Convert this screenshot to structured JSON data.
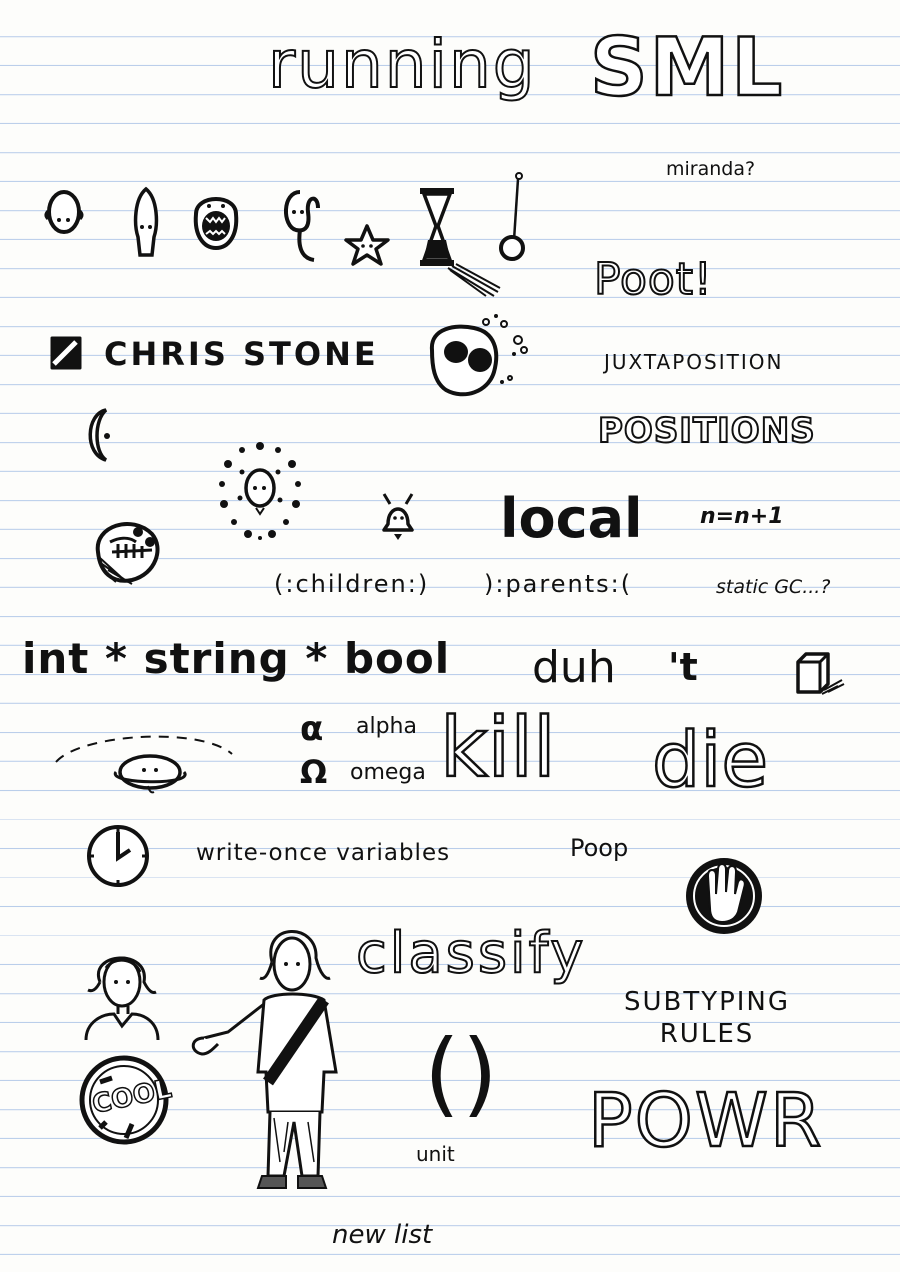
{
  "title": {
    "word1": "running",
    "word2": "SML"
  },
  "words": {
    "miranda": "miranda?",
    "poot": "Poot!",
    "chris_stone": "CHRIS STONE",
    "juxtaposition": "JUXTAPOSITION",
    "positions": "POSITIONS",
    "local": "local",
    "increment": "n=n+1",
    "children": "(:children:)",
    "parents": "):parents:(",
    "static_gc": "static GC...?",
    "tuple_type": "int * string * bool",
    "duh": "duh",
    "tick_t": "'t",
    "alpha_symbol": "α",
    "alpha": "alpha",
    "omega_symbol": "Ω",
    "omega": "omega",
    "kill": "kill",
    "die": "die",
    "write_once": "write-once variables",
    "poop": "Poop",
    "classify": "classify",
    "subtyping_rules": "SUBTYPING RULES",
    "cool": "COOL",
    "unit_parens": "()",
    "unit": "unit",
    "powr": "POWR",
    "new_list": "new list"
  },
  "icons": [
    "bald-head-icon",
    "mushroom-head-icon",
    "screaming-face-icon",
    "squiggle-creature-icon",
    "star-face-icon",
    "hourglass-icon",
    "pendulum-icon",
    "skull-icon",
    "crescent-moon-icon",
    "sun-face-icon",
    "bell-icon",
    "helmet-head-icon",
    "saturn-face-icon",
    "clock-icon",
    "stop-hand-icon",
    "person-bust-icon",
    "standing-person-icon",
    "cool-badge-icon",
    "cube-icon"
  ]
}
